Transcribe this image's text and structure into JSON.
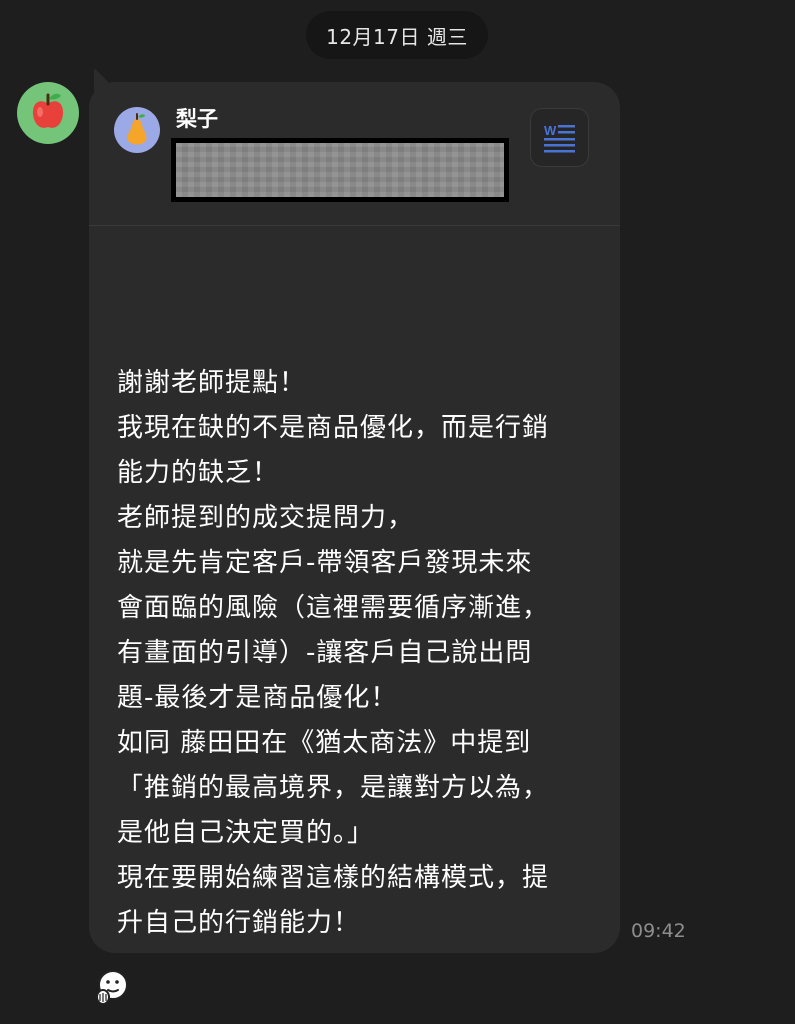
{
  "chat": {
    "date_divider": "12月17日 週三",
    "sender_avatar_icon": "apple-icon",
    "quoted": {
      "avatar_icon": "pear-icon",
      "name": "梨子",
      "attachment_icon": "word-document-icon",
      "redacted": true
    },
    "message_lines": [
      "謝謝老師提點！",
      "我現在缺的不是商品優化，而是行銷",
      "能力的缺乏！",
      "老師提到的成交提問力，",
      "就是先肯定客戶-帶領客戶發現未來",
      "會面臨的風險（這裡需要循序漸進，",
      "有畫面的引導）-讓客戶自己說出問",
      "題-最後才是商品優化！",
      "如同 藤田田在《猶太商法》中提到",
      "「推銷的最高境界，是讓對方以為，",
      "是他自己決定買的。」",
      "現在要開始練習這樣的結構模式，提",
      "升自己的行銷能力！"
    ],
    "timestamp": "09:42",
    "reaction_icon": "sticker-reaction-icon"
  },
  "colors": {
    "background": "#1e1e1e",
    "bubble": "#2b2b2b",
    "avatar_green": "#74c47a",
    "avatar_lavender": "#9ba9e6",
    "word_blue": "#4a73d6"
  }
}
